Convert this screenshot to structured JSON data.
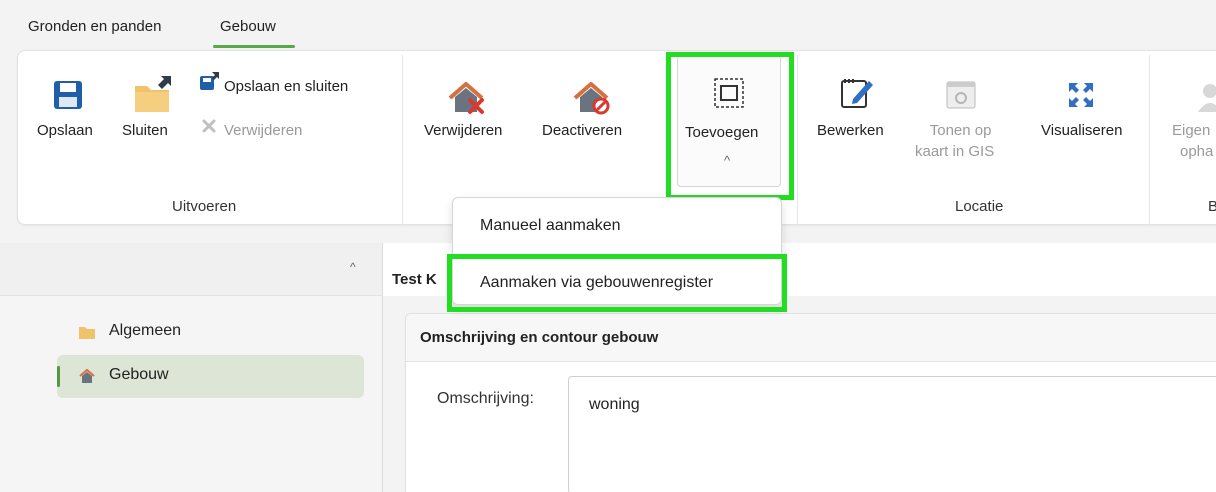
{
  "tabs": [
    "Gronden en panden",
    "Gebouw"
  ],
  "ribbon": {
    "uitvoeren": {
      "opslaan": "Opslaan",
      "sluiten": "Sluiten",
      "opslaan_sluiten": "Opslaan en sluiten",
      "verwijderen_small": "Verwijderen",
      "group_label": "Uitvoeren"
    },
    "gebouw": {
      "verwijderen": "Verwijderen",
      "deactiveren": "Deactiveren",
      "toevoegen": "Toevoegen",
      "toevoegen_caret": "^"
    },
    "locatie": {
      "bewerken": "Bewerken",
      "tonen_line1": "Tonen op",
      "tonen_line2": "kaart in GIS",
      "visualiseren": "Visualiseren",
      "group_label": "Locatie"
    },
    "extra": {
      "eigen_line1": "Eigen",
      "eigen_line2": "opha",
      "group_label_partial": "B"
    }
  },
  "dropdown": {
    "items": [
      "Manueel aanmaken",
      "Aanmaken via gebouwenregister"
    ]
  },
  "nav": {
    "collapse_caret": "^",
    "items": [
      {
        "label": "Algemeen",
        "icon": "folder-icon"
      },
      {
        "label": "Gebouw",
        "icon": "house-icon"
      }
    ]
  },
  "main": {
    "title": "Test K",
    "card_title": "Omschrijving en contour gebouw",
    "field_label": "Omschrijving:",
    "field_value": "woning"
  },
  "colors": {
    "highlight": "#22dd22",
    "accent_green": "#4f9a3f",
    "save_blue": "#1f5fa8"
  }
}
